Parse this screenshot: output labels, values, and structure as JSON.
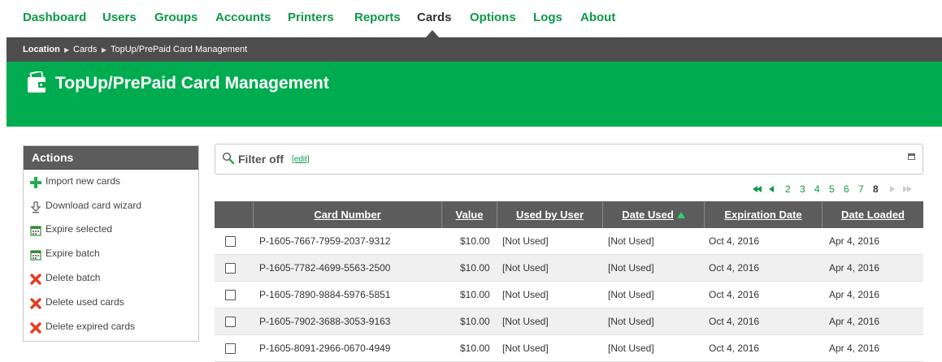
{
  "nav": {
    "items": [
      "Dashboard",
      "Users",
      "Groups",
      "Accounts",
      "Printers",
      "Reports",
      "Cards",
      "Options",
      "Logs",
      "About"
    ],
    "active": "Cards"
  },
  "breadcrumb": {
    "location": "Location",
    "cards": "Cards",
    "current": "TopUp/PrePaid Card Management"
  },
  "header": {
    "title": "TopUp/PrePaid Card Management",
    "icon": "wallet-icon"
  },
  "actions": {
    "title": "Actions",
    "items": [
      {
        "label": "Import new cards",
        "icon": "plus-icon"
      },
      {
        "label": "Download card wizard",
        "icon": "download-icon"
      },
      {
        "label": "Expire selected",
        "icon": "calendar-icon"
      },
      {
        "label": "Expire batch",
        "icon": "calendar-icon"
      },
      {
        "label": "Delete batch",
        "icon": "delete-icon"
      },
      {
        "label": "Delete used cards",
        "icon": "delete-icon"
      },
      {
        "label": "Delete expired cards",
        "icon": "delete-icon"
      }
    ]
  },
  "filter": {
    "text": "Filter off",
    "edit": "[edit]"
  },
  "pager": {
    "pages": [
      "2",
      "3",
      "4",
      "5",
      "6",
      "7",
      "8"
    ],
    "current": "8"
  },
  "table": {
    "columns": [
      "Card Number",
      "Value",
      "Used by User",
      "Date Used",
      "Expiration Date",
      "Date Loaded"
    ],
    "sorted_column": "Date Used",
    "rows": [
      [
        "P-1605-7667-7959-2037-9312",
        "$10.00",
        "[Not Used]",
        "[Not Used]",
        "Oct 4, 2016",
        "Apr 4, 2016"
      ],
      [
        "P-1605-7782-4699-5563-2500",
        "$10.00",
        "[Not Used]",
        "[Not Used]",
        "Oct 4, 2016",
        "Apr 4, 2016"
      ],
      [
        "P-1605-7890-9884-5976-5851",
        "$10.00",
        "[Not Used]",
        "[Not Used]",
        "Oct 4, 2016",
        "Apr 4, 2016"
      ],
      [
        "P-1605-7902-3688-3053-9163",
        "$10.00",
        "[Not Used]",
        "[Not Used]",
        "Oct 4, 2016",
        "Apr 4, 2016"
      ],
      [
        "P-1605-8091-2966-0670-4949",
        "$10.00",
        "[Not Used]",
        "[Not Used]",
        "Oct 4, 2016",
        "Apr 4, 2016"
      ]
    ]
  },
  "colors": {
    "brand_green": "#00ac4f",
    "link_green": "#0b9a47",
    "dark_bar": "#4d4d4d",
    "table_header": "#5c5c5c"
  }
}
